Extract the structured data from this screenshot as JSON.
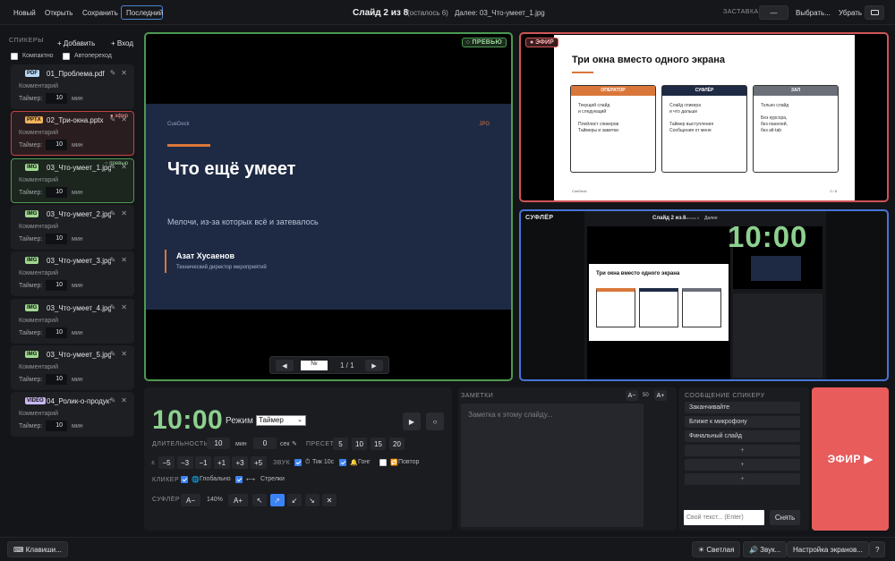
{
  "topbar": {
    "new_label": "Новый",
    "open_label": "Открыть",
    "save_label": "Сохранить",
    "recent_label": "Последний",
    "slide_title": "Слайд 2 из 8",
    "slide_remaining": "(осталось 6)",
    "next_label": "Далее: 03_Что-умеет_1.jpg",
    "screensaver_label": "ЗАСТАВКА",
    "screensaver_value": "—",
    "choose_label": "Выбрать...",
    "remove_label": "Убрать"
  },
  "sidebar": {
    "title": "СПИКЕРЫ",
    "add_label": "+ Добавить",
    "login_label": "+ Вход",
    "compact_label": "Компактно",
    "autoadvance_label": "Автопереход",
    "comment_placeholder": "Комментарий",
    "timer_label": "Таймер:",
    "min_label": "мин",
    "cards": [
      {
        "type": "PDF",
        "kind": "pdf",
        "name": "01_Проблема.pdf",
        "timer": "10",
        "status": ""
      },
      {
        "type": "PPTX",
        "kind": "pptx",
        "name": "02_Три-окна.pptx",
        "timer": "10",
        "status": "● эфир"
      },
      {
        "type": "IMG",
        "kind": "img",
        "name": "03_Что-умеет_1.jpg",
        "timer": "10",
        "status": "○ превью"
      },
      {
        "type": "IMG",
        "kind": "img",
        "name": "03_Что-умеет_2.jpg",
        "timer": "10",
        "status": ""
      },
      {
        "type": "IMG",
        "kind": "img",
        "name": "03_Что-умеет_3.jpg",
        "timer": "10",
        "status": ""
      },
      {
        "type": "IMG",
        "kind": "img",
        "name": "03_Что-умеет_4.jpg",
        "timer": "10",
        "status": ""
      },
      {
        "type": "IMG",
        "kind": "img",
        "name": "03_Что-умеет_5.jpg",
        "timer": "10",
        "status": ""
      },
      {
        "type": "VIDEO",
        "kind": "video",
        "name": "04_Ролик-о-продукте.mp4",
        "timer": "10",
        "status": ""
      }
    ]
  },
  "preview": {
    "badge": "○ ПРЕВЬЮ",
    "brand_left": "CueDeck",
    "brand_right": "JPG",
    "heading": "Что ещё умеет",
    "subtitle": "Мелочи, из-за которых всё и затевалось",
    "author": "Азат Хусаенов",
    "author_role": "Технический директор мероприятий",
    "page_value": "№",
    "page_count": "1 / 1"
  },
  "live": {
    "badge": "● ЭФИР",
    "slide_title": "Три окна вместо одного экрана",
    "columns": [
      {
        "head": "ОПЕРАТОР",
        "body": "Текущий слайд\nи следующий\n\nПлейлист спикеров\nТаймеры и заметки",
        "color": "#d9773a"
      },
      {
        "head": "СУФЛЁР",
        "body": "Слайд спикера\nи что дальше\n\nТаймер выступления\nСообщения от меня",
        "color": "#1f2a44"
      },
      {
        "head": "ЗАЛ",
        "body": "Только слайд\n\nБез курсора,\nбез панелей,\nбез alt-tab",
        "color": "#6b6f78"
      }
    ],
    "footer_left": "CueDeck",
    "footer_right": "2 / 8"
  },
  "prompter": {
    "badge": "СУФЛЁР",
    "mini_title": "Слайд 2 из 8",
    "mini_remaining": "осталось 6",
    "mini_next": "Далее",
    "big_timer": "10:00",
    "mini_slide_title": "Три окна вместо одного экрана"
  },
  "timer": {
    "value": "10:00",
    "mode_label": "Режим",
    "mode_value": "Таймер",
    "play_icon": "▶",
    "reset_icon": "○",
    "duration_label": "ДЛИТЕЛЬНОСТЬ",
    "duration_min": "10",
    "min_label": "мин",
    "duration_sec": "0",
    "sec_label": "сек",
    "preset_label": "ПРЕСЕТ",
    "presets": [
      "5",
      "10",
      "15",
      "20"
    ],
    "adjust_prefix": "±",
    "adjusts": [
      "−5",
      "−3",
      "−1",
      "+1",
      "+3",
      "+5"
    ],
    "sound_label": "ЗВУК",
    "tick_label": "Тик 10с",
    "gong_label": "Гонг",
    "repeat_label": "Повтор",
    "clicker_label": "КЛИКЕР",
    "global_label": "Глобально",
    "arrows_label": "Стрелки",
    "prompter_label": "СУФЛЁР",
    "zoom_out": "A−",
    "zoom_value": "140%",
    "zoom_in": "A+",
    "corners": [
      "↖",
      "↗",
      "↙",
      "↘",
      "✕"
    ]
  },
  "notes": {
    "title": "ЗАМЕТКИ",
    "font_minus": "A−",
    "font_value": "50",
    "font_plus": "A+",
    "placeholder": "Заметка к этому слайду..."
  },
  "messages": {
    "title": "СООБЩЕНИЕ СПИКЕРУ",
    "items": [
      "Заканчивайте",
      "Ближе к микрофону",
      "Финальный слайд",
      "+",
      "+",
      "+"
    ],
    "input_placeholder": "Свой текст... (Enter)",
    "clear_label": "Снять"
  },
  "onair_label": "ЭФИР ▶",
  "footer": {
    "keys_label": "⌨ Клавиши...",
    "light_label": "☀ Светлая",
    "sound_label": "🔊 Звук...",
    "screens_label": "Настройка экранов...",
    "help_label": "?"
  },
  "colors": {
    "preview_border": "#4c9a50",
    "live_border": "#d05555",
    "prompter_border": "#4775d6",
    "accent_orange": "#d9773a",
    "timer_green": "#8dd08f",
    "onair_red": "#e85c5c"
  }
}
